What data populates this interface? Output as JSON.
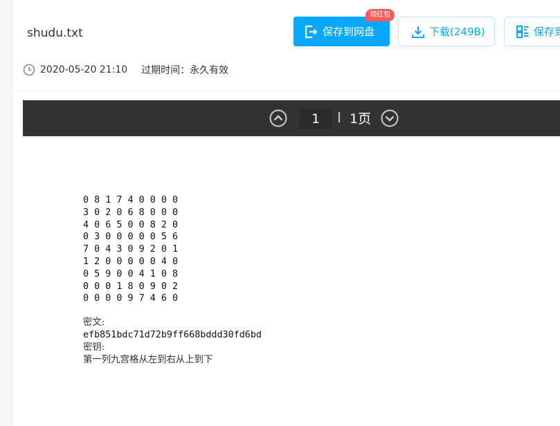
{
  "file": {
    "name": "shudu.txt"
  },
  "actions": {
    "save_label": "保存到网盘",
    "badge_label": "领红包",
    "download_label": "下载(249B)",
    "save_text_label": "保存到"
  },
  "meta": {
    "time": "2020-05-20 21:10",
    "expiry": "过期时间：永久有效"
  },
  "pager": {
    "current": "1",
    "total": "1页"
  },
  "content": {
    "grid": [
      "0 8 1 7 4 0 0 0 0",
      "3 0 2 0 6 8 0 0 0",
      "4 0 6 5 0 0 8 2 0",
      "0 3 0 0 0 0 0 5 6",
      "7 0 4 3 0 9 2 0 1",
      "1 2 0 0 0 0 0 4 0",
      "0 5 9 0 0 4 1 0 8",
      "0 0 0 1 8 0 9 0 2",
      "0 0 0 0 9 7 4 6 0"
    ],
    "ciphertext_label": "密文:",
    "ciphertext": "efb851bdc71d72b9ff668bddd30fd6bd",
    "key_label": "密钥:",
    "key": "第一列九宫格从左到右从上到下"
  },
  "colors": {
    "accent": "#06a7ff",
    "badge": "#f55b5b",
    "toolbar": "#333333"
  },
  "icons": [
    "save-to-disk-icon",
    "download-icon",
    "save-text-icon",
    "clock-icon",
    "chevron-up-icon",
    "chevron-down-icon"
  ]
}
